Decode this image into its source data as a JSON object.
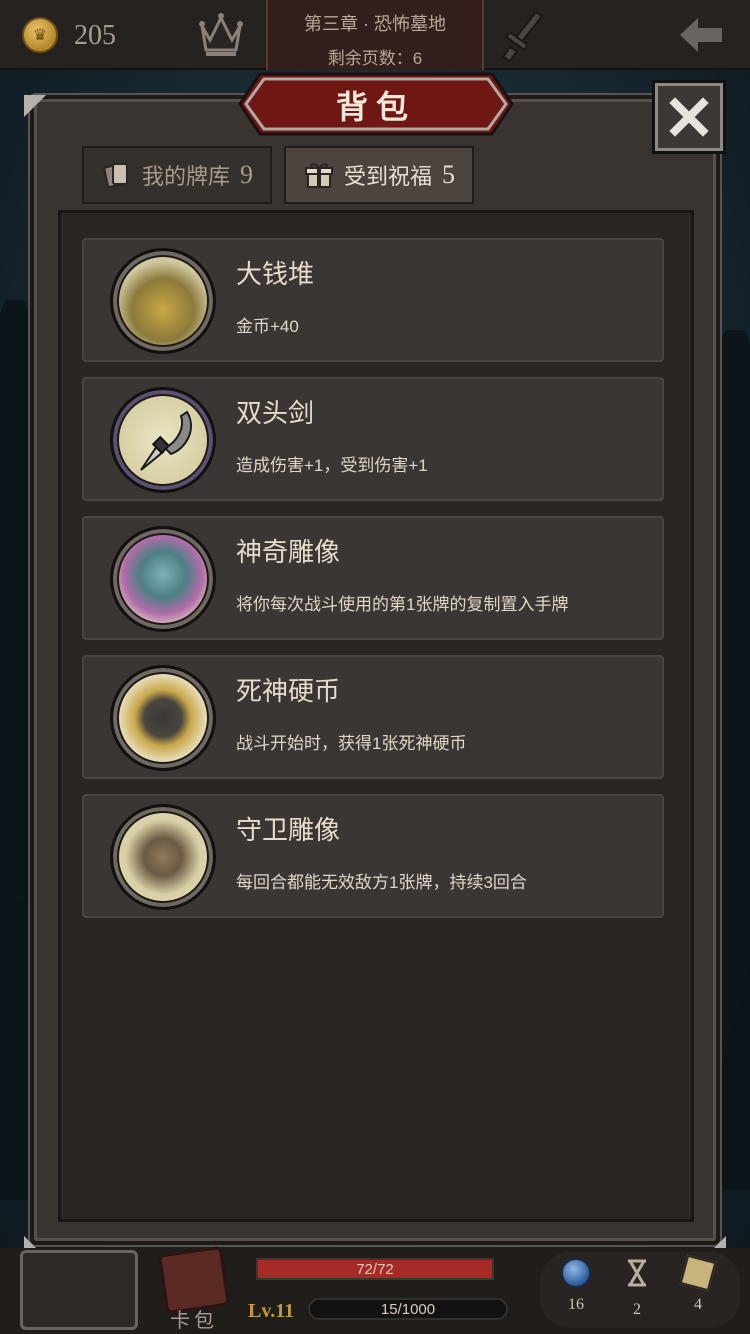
{
  "top_bar": {
    "coins": "205",
    "chapter_title": "第三章 · 恐怖墓地",
    "pages_remaining": "剩余页数：6"
  },
  "panel": {
    "title": "背包",
    "tabs": [
      {
        "label": "我的牌库",
        "count": "9"
      },
      {
        "label": "受到祝福",
        "count": "5"
      }
    ],
    "items": [
      {
        "name": "大钱堆",
        "desc": "金币+40",
        "icon": "treasure-pile-icon"
      },
      {
        "name": "双头剑",
        "desc": "造成伤害+1，受到伤害+1",
        "icon": "double-blade-icon"
      },
      {
        "name": "神奇雕像",
        "desc": "将你每次战斗使用的第1张牌的复制置入手牌",
        "icon": "gargoyle-statue-icon"
      },
      {
        "name": "死神硬币",
        "desc": "战斗开始时，获得1张死神硬币",
        "icon": "death-coin-icon"
      },
      {
        "name": "守卫雕像",
        "desc": "每回合都能无效敌方1张牌，持续3回合",
        "icon": "guardian-statue-icon"
      }
    ]
  },
  "bottom_bar": {
    "card_pack_label": "卡包",
    "hp_text": "72/72",
    "hp_fraction": 1.0,
    "level": "Lv.11",
    "xp_text": "15/1000",
    "stats": [
      "16",
      "2",
      "4"
    ]
  },
  "colors": {
    "accent_red": "#a62a25",
    "gold": "#c19a3a",
    "panel_bg": "#2a2624"
  }
}
